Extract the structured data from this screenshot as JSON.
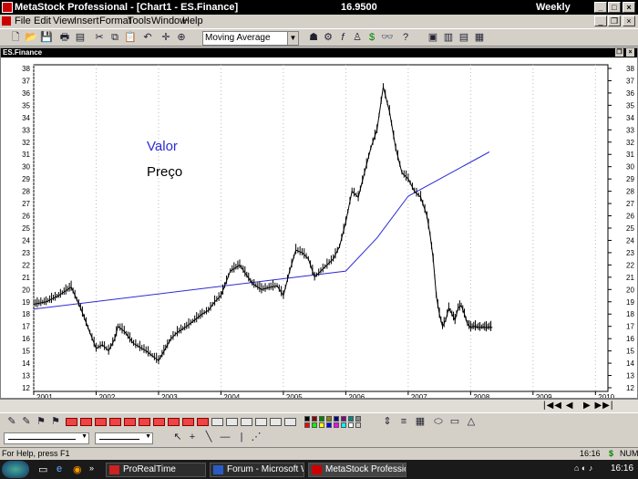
{
  "window": {
    "title": "MetaStock Professional - [Chart1 - ES.Finance]",
    "last_price": "16.9500",
    "periodicity": "Weekly"
  },
  "menu": [
    "File",
    "Edit",
    "View",
    "Insert",
    "Format",
    "Tools",
    "Window",
    "Help"
  ],
  "toolbar": {
    "indicator_value": "Moving Average"
  },
  "chart": {
    "security_name": "ES.Finance",
    "legend_valor": "Valor",
    "legend_preco": "Preço",
    "colors": {
      "price": "#000000",
      "valor": "#2b2bd6",
      "background": "#ffffff"
    }
  },
  "chart_data": {
    "type": "line",
    "ylim": [
      12,
      38
    ],
    "y_ticks": [
      12,
      13,
      14,
      15,
      16,
      17,
      18,
      19,
      20,
      21,
      22,
      23,
      24,
      25,
      26,
      27,
      28,
      29,
      30,
      31,
      32,
      33,
      34,
      35,
      36,
      37,
      38
    ],
    "x_ticks": [
      "2001",
      "2002",
      "2003",
      "2004",
      "2005",
      "2006",
      "2007",
      "2008",
      "2009",
      "2010"
    ],
    "x_range": [
      2001,
      2010.2
    ],
    "series": [
      {
        "name": "Valor",
        "x": [
          2001.0,
          2006.0,
          2006.5,
          2007.0,
          2008.3
        ],
        "y": [
          18.4,
          21.5,
          24.2,
          27.6,
          31.2
        ]
      },
      {
        "name": "Preço",
        "x": [
          2001.0,
          2001.2,
          2001.4,
          2001.6,
          2001.75,
          2001.9,
          2002.0,
          2002.1,
          2002.2,
          2002.3,
          2002.35,
          2002.45,
          2002.6,
          2002.7,
          2002.8,
          2002.9,
          2003.0,
          2003.2,
          2003.3,
          2003.45,
          2003.55,
          2003.7,
          2003.8,
          2003.9,
          2004.0,
          2004.15,
          2004.3,
          2004.5,
          2004.65,
          2004.8,
          2004.9,
          2005.0,
          2005.1,
          2005.2,
          2005.3,
          2005.4,
          2005.5,
          2005.6,
          2005.7,
          2005.8,
          2005.9,
          2006.0,
          2006.1,
          2006.2,
          2006.3,
          2006.4,
          2006.5,
          2006.6,
          2006.7,
          2006.8,
          2006.9,
          2007.0,
          2007.1,
          2007.2,
          2007.3,
          2007.35,
          2007.4,
          2007.45,
          2007.5,
          2007.55,
          2007.6,
          2007.65,
          2007.7,
          2007.75,
          2007.8,
          2007.85,
          2007.9,
          2007.95,
          2008.0,
          2008.05,
          2008.1,
          2008.15,
          2008.2,
          2008.25,
          2008.3,
          2008.35
        ],
        "y": [
          18.8,
          19.0,
          19.5,
          20.2,
          18.5,
          16.5,
          15.2,
          15.5,
          15.0,
          16.0,
          17.0,
          16.6,
          15.6,
          15.3,
          15.0,
          14.6,
          14.2,
          16.0,
          16.5,
          17.0,
          17.4,
          18.0,
          18.3,
          19.0,
          19.5,
          21.5,
          22.0,
          20.5,
          20.0,
          20.2,
          20.3,
          19.5,
          21.5,
          23.2,
          23.0,
          22.5,
          21.0,
          21.5,
          22.0,
          22.5,
          23.5,
          25.5,
          28.0,
          27.5,
          29.5,
          31.5,
          33.0,
          36.5,
          34.5,
          31.5,
          29.5,
          29.0,
          28.0,
          27.5,
          26.0,
          24.5,
          22.5,
          19.5,
          18.0,
          17.0,
          17.5,
          18.5,
          18.0,
          17.5,
          18.5,
          18.7,
          18.0,
          17.2,
          16.9,
          17.0,
          16.95,
          16.9,
          16.95,
          16.9,
          16.95,
          16.9
        ]
      }
    ]
  },
  "status": {
    "help_text": "For Help, press F1",
    "time": "16:16",
    "dollar": "$",
    "num": "NUM"
  },
  "taskbar": {
    "tasks": [
      "ProRealTime",
      "Forum - Microsoft Word",
      "MetaStock Profession..."
    ],
    "clock": "16:16"
  }
}
